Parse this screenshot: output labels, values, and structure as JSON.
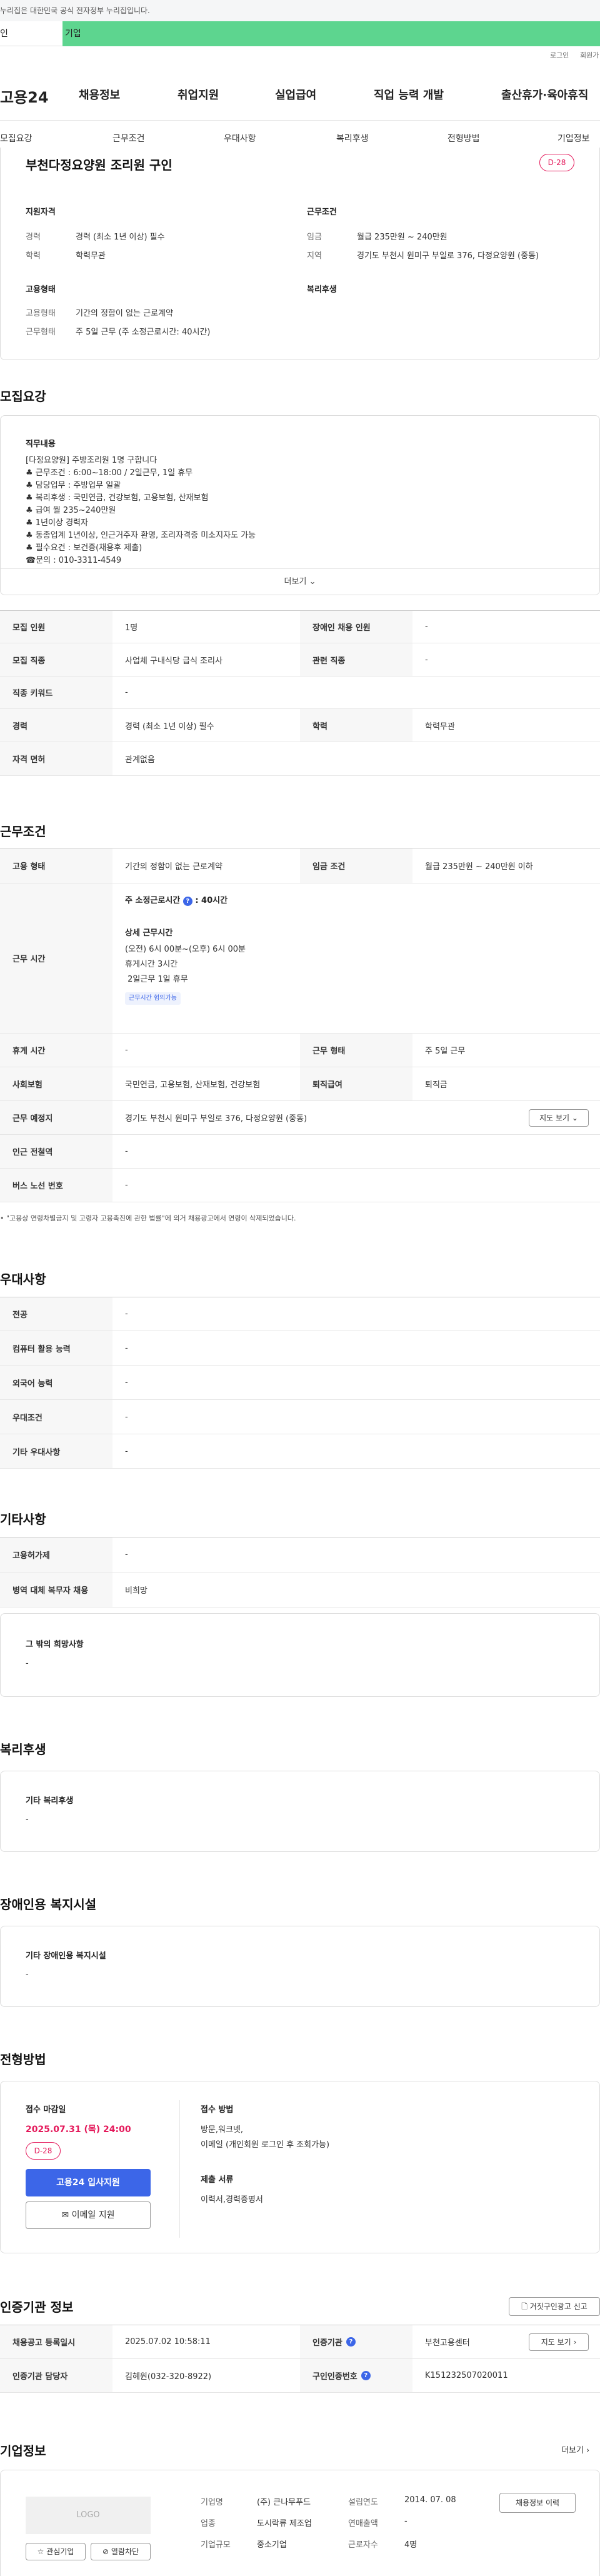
{
  "gov_banner": "누리집은 대한민국 공식 전자정부 누리집입니다.",
  "tabs": {
    "tab1": "인",
    "tab2": "기업"
  },
  "util": {
    "login": "로그인",
    "join": "회원가"
  },
  "brand": "고용24",
  "gnb": [
    "채용정보",
    "취업지원",
    "실업급여",
    "직업 능력 개발",
    "출산휴가·육아휴직"
  ],
  "sub_nav": [
    "모집요강",
    "근무조건",
    "우대사항",
    "복리후생",
    "전형방법",
    "기업정보"
  ],
  "job": {
    "title": "부천다정요양원 조리원 구인",
    "dday": "D-28",
    "qual_title": "지원자격",
    "qual": [
      {
        "label": "경력",
        "value": "경력 (최소 1년 이상) 필수"
      },
      {
        "label": "학력",
        "value": "학력무관"
      }
    ],
    "cond_title": "근무조건",
    "cond": [
      {
        "label": "임금",
        "value": "월급 235만원 ~ 240만원"
      },
      {
        "label": "지역",
        "value": "경기도 부천시 원미구 부일로 376, 다정요양원 (중동)"
      }
    ],
    "emp_title": "고용형태",
    "emp": [
      {
        "label": "고용형태",
        "value": "기간의 정함이 없는 근로계약"
      },
      {
        "label": "근무형태",
        "value": "주 5일 근무 (주 소정근로시간: 40시간)"
      }
    ],
    "welfare_title": "복리후생"
  },
  "recruit": {
    "heading": "모집요강",
    "duty_title": "직무내용",
    "duty_lines": [
      "[다정요양원] 주방조리원 1명 구합니다",
      "♣ 근무조건 :  6:00~18:00 / 2일근무, 1일 휴무",
      "♣ 담당업무 : 주방업무 일괄",
      "♣ 복리후생 : 국민연금, 건강보험, 고용보험, 산재보험",
      "♣ 급여 월 235~240만원",
      "♣ 1년이상 경력자",
      "♣ 동종업계 1년이상, 인근거주자 환영, 조리자격증 미소지자도 가능",
      "♣ 필수요건 : 보건증(채용후 제출)",
      "☎문의 : 010-3311-4549"
    ],
    "more": "더보기",
    "table": [
      [
        {
          "th": "모집 인원",
          "td": "1명"
        },
        {
          "th": "장애인 채용 인원",
          "td": "-"
        }
      ],
      [
        {
          "th": "모집 직종",
          "td": "사업체 구내식당 급식 조리사"
        },
        {
          "th": "관련 직종",
          "td": "-"
        }
      ],
      [
        {
          "th": "직종 키워드",
          "td": "-"
        }
      ],
      [
        {
          "th": "경력",
          "td": "경력 (최소 1년 이상) 필수"
        },
        {
          "th": "학력",
          "td": "학력무관"
        }
      ],
      [
        {
          "th": "자격 면허",
          "td": "관계없음"
        }
      ]
    ]
  },
  "work": {
    "heading": "근무조건",
    "emp_type_th": "고용 형태",
    "emp_type_td": "기간의 정함이 없는 근로계약",
    "wage_th": "임금 조건",
    "wage_td": "월급 235만원 ~ 240만원 이하",
    "hours_th": "근무 시간",
    "hours_week": "주 소정근로시간",
    "hours_week_val": ": 40시간",
    "hours_detail_title": "상세 근무시간",
    "hours_detail": [
      "(오전) 6시 00분~(오후) 6시 00분",
      "휴게시간 3시간",
      " 2일근무 1일 휴무"
    ],
    "flex_tag": "근무시간 협의가능",
    "break_th": "휴게 시간",
    "break_td": "-",
    "shift_th": "근무 형태",
    "shift_td": "주 5일 근무",
    "ins_th": "사회보험",
    "ins_td": "국민연금, 고용보험, 산재보험, 건강보험",
    "sev_th": "퇴직급여",
    "sev_td": "퇴직금",
    "loc_th": "근무 예정지",
    "loc_td": "경기도 부천시 원미구 부일로 376, 다정요양원 (중동)",
    "map_btn": "지도 보기",
    "subway_th": "인근 전철역",
    "subway_td": "-",
    "bus_th": "버스 노선 번호",
    "bus_td": "-",
    "notice": "\"고용상 연령차별금지 및 고령자 고용촉진에 관한 법률\"에 의거 채용광고에서 연령이 삭제되었습니다."
  },
  "pref": {
    "heading": "우대사항",
    "rows": [
      {
        "th": "전공",
        "td": "-"
      },
      {
        "th": "컴퓨터 활용 능력",
        "td": "-"
      },
      {
        "th": "외국어 능력",
        "td": "-"
      },
      {
        "th": "우대조건",
        "td": "-"
      },
      {
        "th": "기타 우대사항",
        "td": "-"
      }
    ]
  },
  "etc": {
    "heading": "기타사항",
    "rows": [
      {
        "th": "고용허가제",
        "td": "-"
      },
      {
        "th": "병역 대체 복무자 채용",
        "td": "비희망"
      }
    ],
    "hope_title": "그 밖의 희망사항",
    "hope_val": "-"
  },
  "welfare": {
    "heading": "복리후생",
    "title": "기타 복리후생",
    "val": "-"
  },
  "disabled": {
    "heading": "장애인용 복지시설",
    "title": "기타 장애인용 복지시설",
    "val": "-"
  },
  "apply": {
    "heading": "전형방법",
    "deadline_title": "접수 마감일",
    "deadline": "2025.07.31 (목) 24:00",
    "dday": "D-28",
    "apply_btn": "고용24 입사지원",
    "email_btn": "이메일 지원",
    "method_title": "접수 방법",
    "method_lines": [
      "방문,워크넷,",
      "이메일 (개인회원 로그인 후 조회가능)"
    ],
    "docs_title": "제출 서류",
    "docs": "이력서,경력증명서"
  },
  "cert": {
    "heading": "인증기관 정보",
    "report_btn": "거짓구인광고 신고",
    "reg_th": "채용공고 등록일시",
    "reg_td": "2025.07.02 10:58:11",
    "org_th": "인증기관",
    "org_td": "부천고용센터",
    "map_btn": "지도 보기",
    "mgr_th": "인증기관 담당자",
    "mgr_td": "김혜원(032-320-8922)",
    "id_th": "구인인증번호",
    "id_td": "K151232507020011"
  },
  "company": {
    "heading": "기업정보",
    "more": "더보기",
    "logo": "LOGO",
    "fav_btn": "관심기업",
    "block_btn": "열람차단",
    "info": [
      {
        "label": "기업명",
        "value": "(주) 큰나무푸드"
      },
      {
        "label": "업종",
        "value": "도시락류 제조업"
      },
      {
        "label": "기업규모",
        "value": "중소기업"
      }
    ],
    "info2": [
      {
        "label": "설립연도",
        "value": "2014. 07. 08"
      },
      {
        "label": "연매출액",
        "value": "-"
      },
      {
        "label": "근로자수",
        "value": "4명"
      }
    ],
    "jobs_btn": "채용정보 이력"
  },
  "colors": {
    "accent": "#5dd58f",
    "pink": "#e4185a",
    "blue": "#3c66e8",
    "tag": "#3c66e8"
  }
}
